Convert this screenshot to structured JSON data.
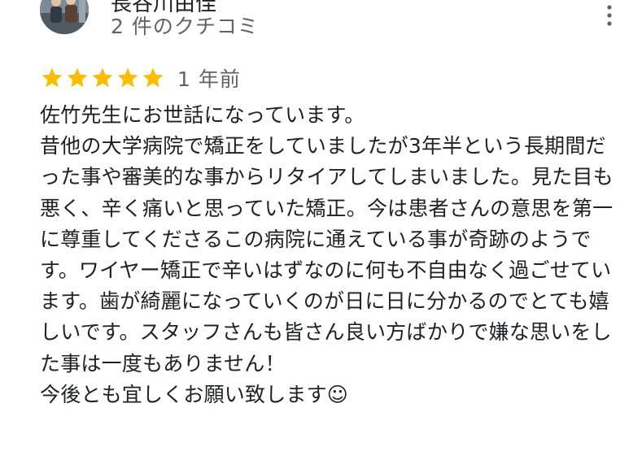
{
  "review": {
    "author": {
      "name": "長谷川由佳",
      "review_count": "2 件のクチコミ",
      "avatar_icon": "user-avatar-photo"
    },
    "more_icon": "more-vert-icon",
    "rating": {
      "stars": 5,
      "max_stars": 5,
      "star_icon": "star-icon",
      "star_color": "#fbbc04"
    },
    "date": "1 年前",
    "text": "佐竹先生にお世話になっています。\n昔他の大学病院で矯正をしていましたが3年半という長期間だった事や審美的な事からリタイアしてしまいました。見た目も悪く、辛く痛いと思っていた矯正。今は患者さんの意思を第一に尊重してくださるこの病院に通えている事が奇跡のようです。ワイヤー矯正で辛いはずなのに何も不自由なく過ごせています。歯が綺麗になっていくのが日に日に分かるのでとても嬉しいです。スタッフさんも皆さん良い方ばかりで嫌な思いをした事は一度もありません！\n今後とも宜しくお願い致します☺"
  }
}
